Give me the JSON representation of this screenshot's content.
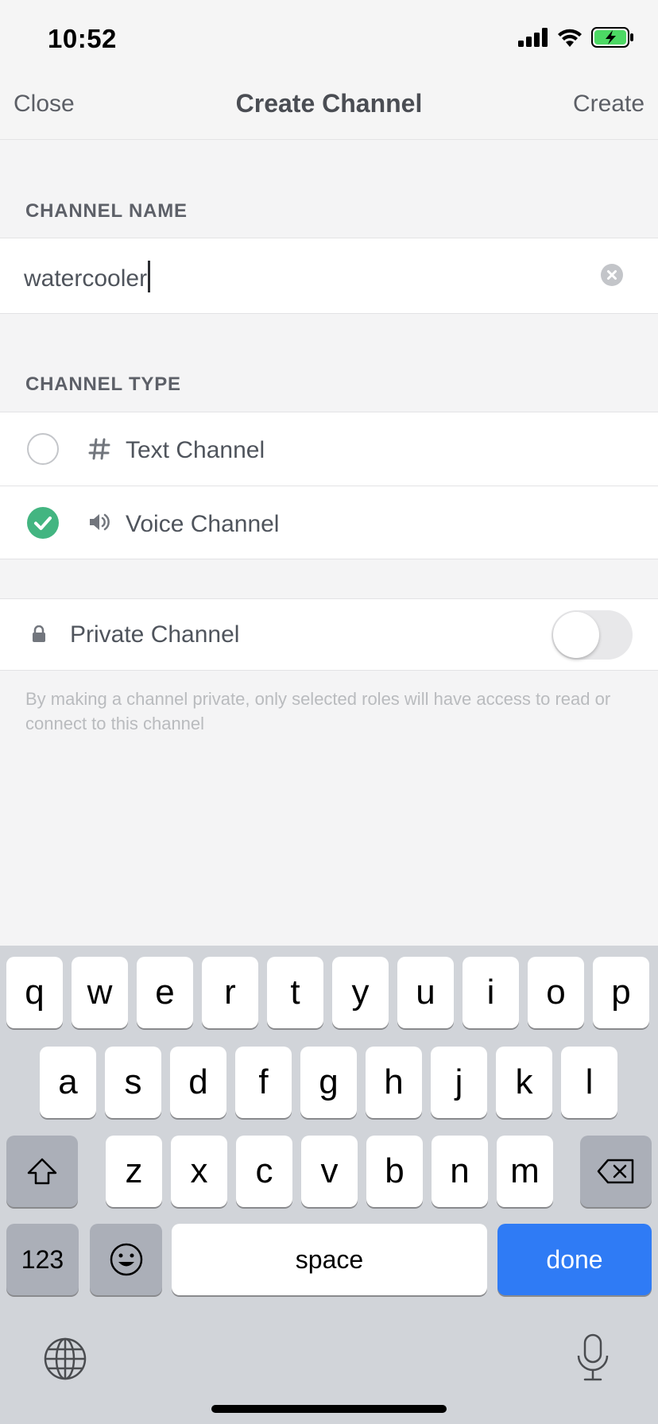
{
  "status": {
    "time": "10:52"
  },
  "nav": {
    "close": "Close",
    "title": "Create Channel",
    "create": "Create"
  },
  "channel_name": {
    "label": "CHANNEL NAME",
    "value": "watercooler"
  },
  "channel_type": {
    "label": "CHANNEL TYPE",
    "options": [
      {
        "label": "Text Channel",
        "icon": "hash-icon",
        "selected": false
      },
      {
        "label": "Voice Channel",
        "icon": "speaker-icon",
        "selected": true
      }
    ]
  },
  "private": {
    "label": "Private Channel",
    "enabled": false,
    "helper": "By making a channel private, only selected roles will have access to read or connect to this channel"
  },
  "keyboard": {
    "row1": [
      "q",
      "w",
      "e",
      "r",
      "t",
      "y",
      "u",
      "i",
      "o",
      "p"
    ],
    "row2": [
      "a",
      "s",
      "d",
      "f",
      "g",
      "h",
      "j",
      "k",
      "l"
    ],
    "row3": [
      "z",
      "x",
      "c",
      "v",
      "b",
      "n",
      "m"
    ],
    "numbers": "123",
    "space": "space",
    "done": "done"
  },
  "colors": {
    "accent_green": "#43b581",
    "keyboard_blue": "#2f7bf5"
  }
}
